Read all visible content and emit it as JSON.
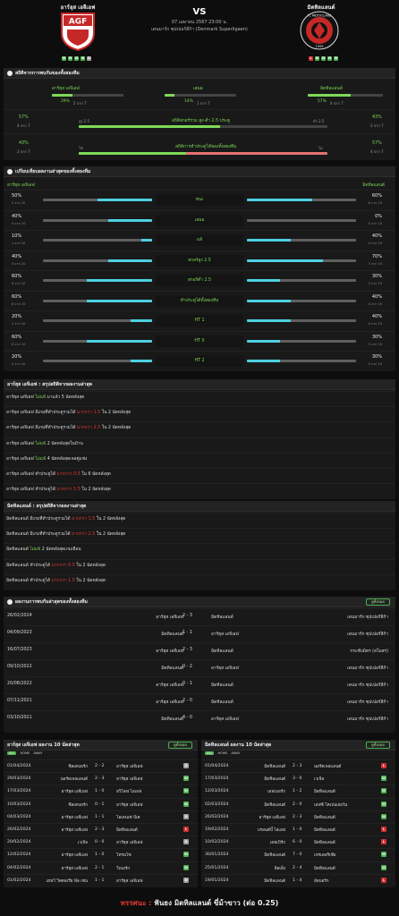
{
  "header": {
    "home_name": "อาร์ฮุส เอจีเอฟ",
    "away_name": "มิดทิลแลนด์",
    "vs": "VS",
    "date": "07 เมษายน 2567 23:00 น.",
    "league": "เดนมาร์ก ซุปเปอร์ลีก้า (Denmark Superligaen)",
    "home_form": [
      "W",
      "W",
      "W",
      "W",
      "D"
    ],
    "away_form": [
      "L",
      "W",
      "W",
      "W",
      "W"
    ],
    "home_badge_text": "AGF",
    "away_badge_text": "FC MIDTJYLLAND",
    "away_badge_year": "1999",
    "colors": {
      "win": "#4caf50",
      "lose": "#d32f2f",
      "draw": "#9e9e9e",
      "accent": "#7ed957",
      "cyan": "#4dd0e1"
    }
  },
  "stats": {
    "title": "สถิติจากการพบกันของทั้งสองทีม",
    "home_label": "อาร์ฮุส เอจีเอฟ",
    "draw_label": "เสมอ",
    "away_label": "มิดทิลแลนด์",
    "home_pct": "29%",
    "home_games": "2 จาก 7",
    "draw_pct": "14%",
    "draw_games": "1 จาก 7",
    "away_pct": "57%",
    "away_games": "4 จาก 7",
    "home_fill": 0.29,
    "draw_fill": 0.14,
    "away_fill": 0.57,
    "ou": {
      "label": "สถิติสกอร์รวม สูง-ต่ำ 2.5 ประตู",
      "left_pct": "57%",
      "left_games": "4 จาก 7",
      "left_word": "สูง 2.5",
      "right_pct": "43%",
      "right_games": "3 จาก 7",
      "right_word": "ต่ำ 2.5",
      "fill": 0.57
    },
    "ah": {
      "label": "สถิติการทำประตูได้ของทั้งสองทีม",
      "left_pct": "43%",
      "left_games": "3 จาก 7",
      "left_word": "ใช่",
      "right_pct": "57%",
      "right_games": "4 จาก 7",
      "right_word": "ไม่",
      "fill": 0.43
    }
  },
  "compare": {
    "title": "เปรียบเทียบผลงานล่าสุดของทั้งสองทีม",
    "home_team": "อาร์ฮุส เอจีเอฟ",
    "away_team": "มิดทิลแลนด์",
    "rows": [
      {
        "label": "ชนะ",
        "home_pct": "50%",
        "home_sub": "5 จาก 10",
        "home_fill": 0.5,
        "away_pct": "60%",
        "away_sub": "6 จาก 10",
        "away_fill": 0.6
      },
      {
        "label": "เสมอ",
        "home_pct": "40%",
        "home_sub": "4 จาก 10",
        "home_fill": 0.4,
        "away_pct": "0%",
        "away_sub": "0 จาก 10",
        "away_fill": 0.0
      },
      {
        "label": "แพ้",
        "home_pct": "10%",
        "home_sub": "1 จาก 10",
        "home_fill": 0.1,
        "away_pct": "40%",
        "away_sub": "4 จาก 10",
        "away_fill": 0.4
      },
      {
        "label": "สกอร์สูง 2.5",
        "home_pct": "40%",
        "home_sub": "4 จาก 10",
        "home_fill": 0.4,
        "away_pct": "70%",
        "away_sub": "7 จาก 10",
        "away_fill": 0.7
      },
      {
        "label": "สกอร์ต่ำ 2.5",
        "home_pct": "60%",
        "home_sub": "6 จาก 10",
        "home_fill": 0.6,
        "away_pct": "30%",
        "away_sub": "3 จาก 10",
        "away_fill": 0.3
      },
      {
        "label": "ทำประตูได้ทั้งสองทีม",
        "home_pct": "60%",
        "home_sub": "6 จาก 10",
        "home_fill": 0.6,
        "away_pct": "40%",
        "away_sub": "4 จาก 10",
        "away_fill": 0.4
      },
      {
        "label": "HT 1",
        "home_pct": "20%",
        "home_sub": "2 จาก 10",
        "home_fill": 0.2,
        "away_pct": "40%",
        "away_sub": "4 จาก 10",
        "away_fill": 0.4
      },
      {
        "label": "HT X",
        "home_pct": "60%",
        "home_sub": "6 จาก 10",
        "home_fill": 0.6,
        "away_pct": "30%",
        "away_sub": "3 จาก 10",
        "away_fill": 0.3
      },
      {
        "label": "HT 2",
        "home_pct": "20%",
        "home_sub": "2 จาก 10",
        "home_fill": 0.2,
        "away_pct": "30%",
        "away_sub": "3 จาก 10",
        "away_fill": 0.3
      }
    ]
  },
  "home_summary": {
    "title": "อาร์ฮุส เอจีเอฟ : สรุปสถิติจากผลงานล่าสุด",
    "rows": [
      {
        "team": "อาร์ฮุส เอจีเอฟ",
        "hl": "ไม่แพ้",
        "hl_color": "green",
        "rest": "มาแล้ว 5 นัดหลังสุด"
      },
      {
        "team": "อาร์ฮุส เอจีเอฟ",
        "pre": "มีเกมที่ทำประตูรวมได้",
        "hl": "มากกว่า 1.5",
        "hl_color": "red",
        "rest": "ใน 2 นัดหลังสุด"
      },
      {
        "team": "อาร์ฮุส เอจีเอฟ",
        "pre": "มีเกมที่ทำประตูรวมได้",
        "hl": "มากกว่า 2.5",
        "hl_color": "red",
        "rest": "ใน 2 นัดหลังสุด"
      },
      {
        "team": "อาร์ฮุส เอจีเอฟ",
        "hl": "ไม่แพ้",
        "hl_color": "green",
        "rest": "2 นัดหลังสุดในบ้าน"
      },
      {
        "team": "อาร์ฮุส เอจีเอฟ",
        "hl": "ไม่แพ้",
        "hl_color": "green",
        "rest": "4 นัดหลังสุดเจอคู่แข่ง"
      },
      {
        "team": "อาร์ฮุส เอจีเอฟ",
        "pre": "ทำประตูได้",
        "hl": "มากกว่า 0.5",
        "hl_color": "red",
        "rest": "ใน 6 นัดหลังสุด"
      },
      {
        "team": "อาร์ฮุส เอจีเอฟ",
        "pre": "ทำประตูได้",
        "hl": "มากกว่า 1.5",
        "hl_color": "red",
        "rest": "ใน 2 นัดหลังสุด"
      }
    ]
  },
  "away_summary": {
    "title": "มิดทิลแลนด์ : สรุปสถิติจากผลงานล่าสุด",
    "rows": [
      {
        "team": "มิดทิลแลนด์",
        "pre": "มีเกมที่ทำประตูรวมได้",
        "hl": "มากกว่า 1.5",
        "hl_color": "red",
        "rest": "ใน 2 นัดหลังสุด"
      },
      {
        "team": "มิดทิลแลนด์",
        "pre": "มีเกมที่ทำประตูรวมได้",
        "hl": "มากกว่า 2.5",
        "hl_color": "red",
        "rest": "ใน 2 นัดหลังสุด"
      },
      {
        "team": "มิดทิลแลนด์",
        "hl": "ไม่แพ้",
        "hl_color": "green",
        "rest": "2 นัดหลังสุดเกมเยือน"
      },
      {
        "team": "มิดทิลแลนด์",
        "pre": "ทำประตูได้",
        "hl": "มากกว่า 0.5",
        "hl_color": "red",
        "rest": "ใน 2 นัดหลังสุด"
      },
      {
        "team": "มิดทิลแลนด์",
        "pre": "ทำประตูได้",
        "hl": "มากกว่า 1.5",
        "hl_color": "red",
        "rest": "ใน 2 นัดหลังสุด"
      }
    ]
  },
  "h2h": {
    "title": "ผลงานการพบกันล่าสุดของทั้งสองทีม",
    "button": "ดูทั้งหมด",
    "rows": [
      {
        "date": "26/02/2024",
        "home": "อาร์ฮุส เอจีเอฟ",
        "score": "2 - 3",
        "away": "มิดทิลแลนด์",
        "comp": "เดนมาร์ก ซุปเปอร์ลีก้า"
      },
      {
        "date": "04/09/2023",
        "home": "มิดทิลแลนด์",
        "score": "1 - 1",
        "away": "อาร์ฮุส เอจีเอฟ",
        "comp": "เดนมาร์ก ซุปเปอร์ลีก้า"
      },
      {
        "date": "16/07/2023",
        "home": "อาร์ฮุส เอจีเอฟ",
        "score": "2 - 3",
        "away": "มิดทิลแลนด์",
        "comp": "กระชับมิตร (สโมสร)"
      },
      {
        "date": "09/10/2022",
        "home": "มิดทิลแลนด์",
        "score": "0 - 2",
        "away": "อาร์ฮุส เอจีเอฟ",
        "comp": "เดนมาร์ก ซุปเปอร์ลีก้า"
      },
      {
        "date": "20/08/2022",
        "home": "อาร์ฮุส เอจีเอฟ",
        "score": "0 - 1",
        "away": "มิดทิลแลนด์",
        "comp": "เดนมาร์ก ซุปเปอร์ลีก้า"
      },
      {
        "date": "07/11/2021",
        "home": "อาร์ฮุส เอจีเอฟ",
        "score": "2 - 0",
        "away": "มิดทิลแลนด์",
        "comp": "เดนมาร์ก ซุปเปอร์ลีก้า"
      },
      {
        "date": "03/10/2021",
        "home": "มิดทิลแลนด์",
        "score": "4 - 0",
        "away": "อาร์ฮุส เอจีเอฟ",
        "comp": "เดนมาร์ก ซุปเปอร์ลีก้า"
      }
    ]
  },
  "home_recent": {
    "title": "อาร์ฮุส เอจีเอฟ ผลงาน 10 นัดล่าสุด",
    "button": "ดูทั้งหมด",
    "tabs": [
      "ALL",
      "HOME",
      "AWAY"
    ],
    "rows": [
      {
        "date": "01/04/2024",
        "home": "ซิลเคบอร์ก",
        "score": "2 - 2",
        "away": "อาร์ฮุส เอจีเอฟ",
        "res": "D"
      },
      {
        "date": "29/03/2024",
        "home": "นอร์ดเจลแลนด์",
        "score": "2 - 3",
        "away": "อาร์ฮุส เอจีเอฟ",
        "res": "W"
      },
      {
        "date": "17/03/2024",
        "home": "อาร์ฮุส เอจีเอฟ",
        "score": "1 - 0",
        "away": "ฮวิโดฟ ไอเอฟ",
        "res": "W"
      },
      {
        "date": "10/03/2024",
        "home": "ซิลเคบอร์ก",
        "score": "0 - 1",
        "away": "อาร์ฮุส เอจีเอฟ",
        "res": "W"
      },
      {
        "date": "04/03/2024",
        "home": "อาร์ฮุส เอจีเอฟ",
        "score": "1 - 1",
        "away": "โอเดนเซ่ บีเค",
        "res": "D"
      },
      {
        "date": "26/02/2024",
        "home": "อาร์ฮุส เอจีเอฟ",
        "score": "2 - 3",
        "away": "มิดทิลแลนด์",
        "res": "L"
      },
      {
        "date": "20/02/2024",
        "home": "เวเจิล",
        "score": "0 - 0",
        "away": "อาร์ฮุส เอจีเอฟ",
        "res": "D"
      },
      {
        "date": "12/02/2024",
        "home": "อาร์ฮุส เอจีเอฟ",
        "score": "1 - 0",
        "away": "โทรมโซ",
        "res": "W"
      },
      {
        "date": "04/02/2024",
        "home": "อาร์ฮุส เอจีเอฟ",
        "score": "2 - 1",
        "away": "วีเบอร์ก",
        "res": "W"
      },
      {
        "date": "01/02/2024",
        "home": "เฮฟวี วิคตอเรีย พีล เซ่น",
        "score": "1 - 1",
        "away": "อาร์ฮุส เอจีเอฟ",
        "res": "D"
      }
    ]
  },
  "away_recent": {
    "title": "มิดทิลแลนด์ ผลงาน 10 นัดล่าสุด",
    "button": "ดูทั้งหมด",
    "tabs": [
      "ALL",
      "HOME",
      "AWAY"
    ],
    "rows": [
      {
        "date": "01/04/2024",
        "home": "มิดทิลแลนด์",
        "score": "2 - 3",
        "away": "นอร์ดเจลแลนด์",
        "res": "L"
      },
      {
        "date": "17/03/2024",
        "home": "มิดทิลแลนด์",
        "score": "3 - 0",
        "away": "เวเจิล",
        "res": "W"
      },
      {
        "date": "12/03/2024",
        "home": "เอฟเบอร์ก",
        "score": "1 - 2",
        "away": "มิดทิลแลนด์",
        "res": "W"
      },
      {
        "date": "02/03/2024",
        "home": "มิดทิลแลนด์",
        "score": "2 - 0",
        "away": "เอฟซี โคเปนเฮเก้น",
        "res": "W"
      },
      {
        "date": "26/02/2024",
        "home": "อาร์ฮุส เอจีเอฟ",
        "score": "2 - 3",
        "away": "มิดทิลแลนด์",
        "res": "W"
      },
      {
        "date": "19/02/2024",
        "home": "บรอนด์บี้ ไอเอฟ",
        "score": "1 - 0",
        "away": "มิดทิลแลนด์",
        "res": "L"
      },
      {
        "date": "10/02/2024",
        "home": "เอฟเบิร์ก",
        "score": "6 - 0",
        "away": "มิดทิลแลนด์",
        "res": "L"
      },
      {
        "date": "30/01/2024",
        "home": "มิดทิลแลนด์",
        "score": "7 - 0",
        "away": "เฟรเดอริเซีย",
        "res": "W"
      },
      {
        "date": "25/01/2024",
        "home": "ลิลเลิ่ง",
        "score": "2 - 4",
        "away": "มิดทิลแลนด์",
        "res": "W"
      },
      {
        "date": "19/01/2024",
        "home": "มิดทิลแลนด์",
        "score": "1 - 4",
        "away": "อัลบอร์ก",
        "res": "L"
      }
    ]
  },
  "footer": {
    "label": "ทรรศนะ :",
    "text": "ฟันธง มิดทิลแลนด์ ขี่ม้าขาว (ต่อ 0.25)"
  }
}
